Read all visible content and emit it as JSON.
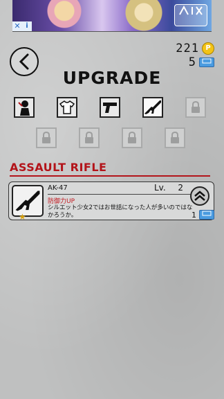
{
  "ad": {
    "close_label": "✕",
    "info_label": "i"
  },
  "currency": {
    "coins": "221",
    "coin_symbol": "P",
    "tickets": "5"
  },
  "page_title": "UPGRADE",
  "section_title": "ASSAULT RIFLE",
  "card": {
    "weapon_name": "AK-47",
    "level_label": "Lv.",
    "level_value": "2",
    "effect": "防御力UP",
    "description": "シルエット少女2ではお世話になった人が多いのではなかろうか。",
    "upgrade_cost": "1"
  },
  "colors": {
    "accent_red": "#b3141a",
    "coin": "#f3c316",
    "ticket": "#4a9be0"
  }
}
